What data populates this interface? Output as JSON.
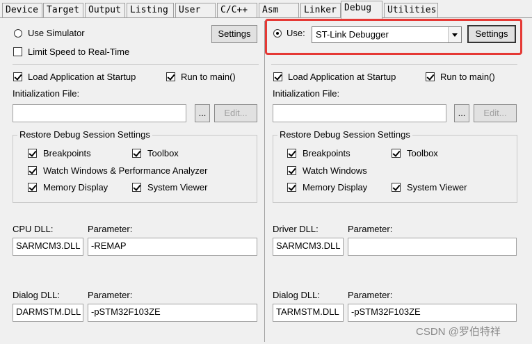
{
  "tabs": [
    "Device",
    "Target",
    "Output",
    "Listing",
    "User",
    "C/C++",
    "Asm",
    "Linker",
    "Debug",
    "Utilities"
  ],
  "active_tab": "Debug",
  "left": {
    "use_simulator": "Use Simulator",
    "limit_speed": "Limit Speed to Real-Time",
    "settings": "Settings",
    "load_app": "Load Application at Startup",
    "run_main": "Run to main()",
    "init_file": "Initialization File:",
    "browse": "...",
    "edit": "Edit...",
    "restore_title": "Restore Debug Session Settings",
    "breakpoints": "Breakpoints",
    "toolbox": "Toolbox",
    "watch": "Watch Windows & Performance Analyzer",
    "memory": "Memory Display",
    "system_viewer": "System Viewer",
    "cpu_dll_label": "CPU DLL:",
    "cpu_param_label": "Parameter:",
    "cpu_dll": "SARMCM3.DLL",
    "cpu_param": "-REMAP",
    "dialog_dll_label": "Dialog DLL:",
    "dialog_param_label": "Parameter:",
    "dialog_dll": "DARMSTM.DLL",
    "dialog_param": "-pSTM32F103ZE"
  },
  "right": {
    "use": "Use:",
    "debugger": "ST-Link Debugger",
    "settings": "Settings",
    "load_app": "Load Application at Startup",
    "run_main": "Run to main()",
    "init_file": "Initialization File:",
    "browse": "...",
    "edit": "Edit...",
    "restore_title": "Restore Debug Session Settings",
    "breakpoints": "Breakpoints",
    "toolbox": "Toolbox",
    "watch": "Watch Windows",
    "memory": "Memory Display",
    "system_viewer": "System Viewer",
    "driver_dll_label": "Driver DLL:",
    "driver_param_label": "Parameter:",
    "driver_dll": "SARMCM3.DLL",
    "driver_param": "",
    "dialog_dll_label": "Dialog DLL:",
    "dialog_param_label": "Parameter:",
    "dialog_dll": "TARMSTM.DLL",
    "dialog_param": "-pSTM32F103ZE"
  },
  "watermark": "CSDN @罗伯特祥",
  "colors": {
    "highlight": "#e53935",
    "panel": "#f0f0f0"
  }
}
